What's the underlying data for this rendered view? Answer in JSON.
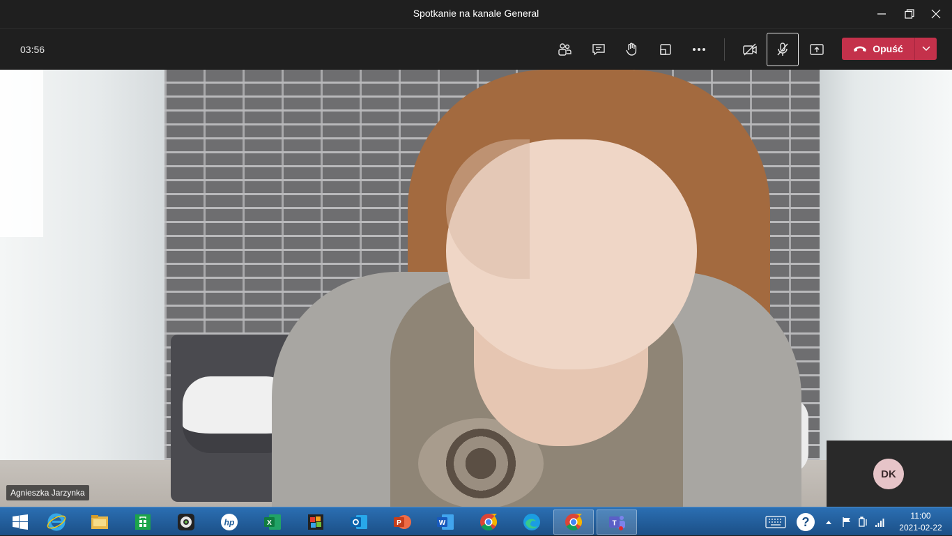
{
  "window": {
    "title": "Spotkanie na kanale General"
  },
  "toolbar": {
    "timer": "03:56",
    "leave_label": "Opuść"
  },
  "video": {
    "participant_name": "Agnieszka Jarzynka",
    "self_initials": "DK"
  },
  "taskbar": {
    "apps": [
      "start",
      "internet-explorer",
      "file-explorer",
      "microsoft-store",
      "webcam-app",
      "hp",
      "excel",
      "puzzle-app",
      "outlook",
      "powerpoint",
      "word",
      "chrome",
      "edge",
      "chrome",
      "teams"
    ],
    "time": "11:00",
    "date": "2021-02-22"
  },
  "colors": {
    "leave_red": "#c4314b",
    "taskbar_blue": "#1e5c9a",
    "teams_purple": "#5b5fc7"
  }
}
